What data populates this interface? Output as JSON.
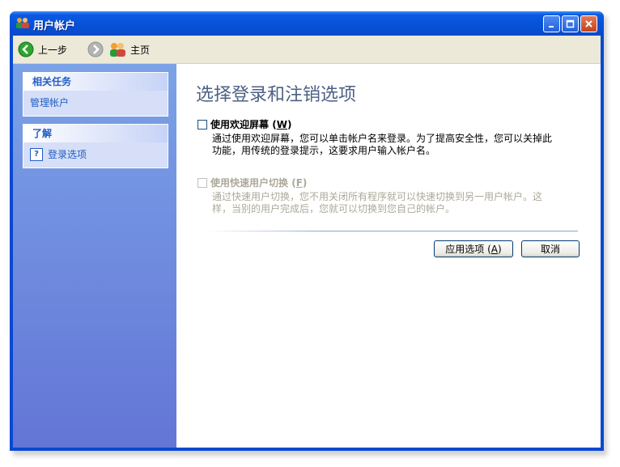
{
  "window": {
    "title": "用户帐户"
  },
  "toolbar": {
    "back_label": "上一步",
    "home_label": "主页"
  },
  "sidebar": {
    "related_tasks": {
      "heading": "相关任务",
      "items": [
        "管理帐户"
      ]
    },
    "learn": {
      "heading": "了解",
      "items": [
        "登录选项"
      ]
    }
  },
  "main": {
    "heading": "选择登录和注销选项",
    "option_welcome": {
      "label": "使用欢迎屏幕",
      "shortcut": "W",
      "checked": false,
      "enabled": true,
      "description": "通过使用欢迎屏幕，您可以单击帐户名来登录。为了提高安全性，您可以关掉此功能，用传统的登录提示，这要求用户输入帐户名。"
    },
    "option_fast_switch": {
      "label": "使用快速用户切换",
      "shortcut": "F",
      "checked": false,
      "enabled": false,
      "description": "通过快速用户切换，您不用关闭所有程序就可以快速切换到另一用户帐户。这样，当别的用户完成后，您就可以切换到您自己的帐户。"
    },
    "apply_label": "应用选项",
    "apply_shortcut": "A",
    "cancel_label": "取消"
  },
  "colors": {
    "titlebar": "#0551d8",
    "sidebar_top": "#7ba2e7",
    "sidebar_bottom": "#6375d6",
    "heading": "#4d6185",
    "link": "#215dc6"
  }
}
